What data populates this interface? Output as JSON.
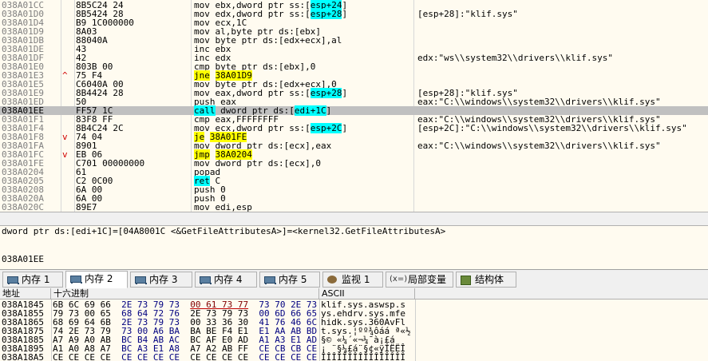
{
  "disasm": {
    "rows": [
      {
        "addr": "038A01CC",
        "jmp": "",
        "hex": "8B5C24 24",
        "ins": [
          {
            "t": "mov ebx,dword ptr ss:["
          },
          {
            "t": "esp+24",
            "hl": "c"
          },
          {
            "t": "]"
          }
        ],
        "cmt": ""
      },
      {
        "addr": "038A01D0",
        "jmp": "",
        "hex": "8B5424 28",
        "ins": [
          {
            "t": "mov edx,dword ptr ss:["
          },
          {
            "t": "esp+28",
            "hl": "c"
          },
          {
            "t": "]"
          }
        ],
        "cmt": "[esp+28]:\"klif.sys\""
      },
      {
        "addr": "038A01D4",
        "jmp": "",
        "hex": "B9 1C000000",
        "ins": [
          {
            "t": "mov ecx,1C"
          }
        ],
        "cmt": ""
      },
      {
        "addr": "038A01D9",
        "jmp": "",
        "hex": "8A03",
        "ins": [
          {
            "t": "mov al,byte ptr ds:[ebx]"
          }
        ],
        "cmt": ""
      },
      {
        "addr": "038A01DB",
        "jmp": "",
        "hex": "88040A",
        "ins": [
          {
            "t": "mov byte ptr ds:[edx+ecx],al"
          }
        ],
        "cmt": ""
      },
      {
        "addr": "038A01DE",
        "jmp": "",
        "hex": "43",
        "ins": [
          {
            "t": "inc ebx"
          }
        ],
        "cmt": ""
      },
      {
        "addr": "038A01DF",
        "jmp": "",
        "hex": "42",
        "ins": [
          {
            "t": "inc edx"
          }
        ],
        "cmt": "edx:\"ws\\\\system32\\\\drivers\\\\klif.sys\""
      },
      {
        "addr": "038A01E0",
        "jmp": "",
        "hex": "803B 00",
        "ins": [
          {
            "t": "cmp byte ptr ds:[ebx],0"
          }
        ],
        "cmt": ""
      },
      {
        "addr": "038A01E3",
        "jmp": "^",
        "hex": "75 F4",
        "ins": [
          {
            "t": "jne",
            "hl": "y"
          },
          {
            "t": " "
          },
          {
            "t": "38A01D9",
            "hl": "y"
          }
        ],
        "cmt": ""
      },
      {
        "addr": "038A01E5",
        "jmp": "",
        "hex": "C6040A 00",
        "ins": [
          {
            "t": "mov byte ptr ds:[edx+ecx],0"
          }
        ],
        "cmt": ""
      },
      {
        "addr": "038A01E9",
        "jmp": "",
        "hex": "8B4424 28",
        "ins": [
          {
            "t": "mov eax,dword ptr ss:["
          },
          {
            "t": "esp+28",
            "hl": "c"
          },
          {
            "t": "]"
          }
        ],
        "cmt": "[esp+28]:\"klif.sys\""
      },
      {
        "addr": "038A01ED",
        "jmp": "",
        "hex": "50",
        "ins": [
          {
            "t": "push eax"
          }
        ],
        "cmt": "eax:\"C:\\\\windows\\\\system32\\\\drivers\\\\klif.sys\""
      },
      {
        "addr": "038A01EE",
        "jmp": "",
        "hex": "FF57 1C",
        "ins": [
          {
            "t": "call",
            "hl": "c"
          },
          {
            "t": " dword ptr ds:["
          },
          {
            "t": "edi+1C",
            "hl": "c"
          },
          {
            "t": "]"
          }
        ],
        "cmt": "",
        "sel": true
      },
      {
        "addr": "038A01F1",
        "jmp": "",
        "hex": "83F8 FF",
        "ins": [
          {
            "t": "cmp eax,FFFFFFFF"
          }
        ],
        "cmt": "eax:\"C:\\\\windows\\\\system32\\\\drivers\\\\klif.sys\""
      },
      {
        "addr": "038A01F4",
        "jmp": "",
        "hex": "8B4C24 2C",
        "ins": [
          {
            "t": "mov ecx,dword ptr ss:["
          },
          {
            "t": "esp+2C",
            "hl": "c"
          },
          {
            "t": "]"
          }
        ],
        "cmt": "[esp+2C]:\"C:\\\\windows\\\\system32\\\\drivers\\\\klif.sys\""
      },
      {
        "addr": "038A01F8",
        "jmp": "v",
        "hex": "74 04",
        "ins": [
          {
            "t": "je",
            "hl": "y"
          },
          {
            "t": " "
          },
          {
            "t": "38A01FE",
            "hl": "y"
          }
        ],
        "cmt": ""
      },
      {
        "addr": "038A01FA",
        "jmp": "",
        "hex": "8901",
        "ins": [
          {
            "t": "mov dword ptr ds:[ecx],eax"
          }
        ],
        "cmt": "eax:\"C:\\\\windows\\\\system32\\\\drivers\\\\klif.sys\""
      },
      {
        "addr": "038A01FC",
        "jmp": "v",
        "hex": "EB 06",
        "ins": [
          {
            "t": "jmp",
            "hl": "y"
          },
          {
            "t": " "
          },
          {
            "t": "38A0204",
            "hl": "y"
          }
        ],
        "cmt": ""
      },
      {
        "addr": "038A01FE",
        "jmp": "",
        "hex": "C701 00000000",
        "ins": [
          {
            "t": "mov dword ptr ds:[ecx],0"
          }
        ],
        "cmt": ""
      },
      {
        "addr": "038A0204",
        "jmp": "",
        "hex": "61",
        "ins": [
          {
            "t": "popad"
          }
        ],
        "cmt": ""
      },
      {
        "addr": "038A0205",
        "jmp": "",
        "hex": "C2 0C00",
        "ins": [
          {
            "t": "ret",
            "hl": "c"
          },
          {
            "t": " C"
          }
        ],
        "cmt": ""
      },
      {
        "addr": "038A0208",
        "jmp": "",
        "hex": "6A 00",
        "ins": [
          {
            "t": "push 0"
          }
        ],
        "cmt": ""
      },
      {
        "addr": "038A020A",
        "jmp": "",
        "hex": "6A 00",
        "ins": [
          {
            "t": "push 0"
          }
        ],
        "cmt": ""
      },
      {
        "addr": "038A020C",
        "jmp": "",
        "hex": "89E7",
        "ins": [
          {
            "t": "mov edi,esp"
          }
        ],
        "cmt": ""
      }
    ]
  },
  "info": {
    "line": "dword ptr ds:[edi+1C]=[04A8001C <&GetFileAttributesA>]=<kernel32.GetFileAttributesA>",
    "address": "038A01EE"
  },
  "tabs": [
    {
      "label": "内存 1",
      "icon": "memory-icon",
      "active": false
    },
    {
      "label": "内存 2",
      "icon": "memory-icon",
      "active": true
    },
    {
      "label": "内存 3",
      "icon": "memory-icon",
      "active": false
    },
    {
      "label": "内存 4",
      "icon": "memory-icon",
      "active": false
    },
    {
      "label": "内存 5",
      "icon": "memory-icon",
      "active": false
    },
    {
      "label": "监视 1",
      "icon": "watch-icon",
      "active": false
    },
    {
      "label": "局部变量",
      "icon": "locals-icon",
      "active": false
    },
    {
      "label": "结构体",
      "icon": "struct-icon",
      "active": false
    }
  ],
  "dump": {
    "headers": {
      "address": "地址",
      "hex": "十六进制",
      "ascii": "ASCII"
    },
    "rows": [
      {
        "addr": "038A1845",
        "g": [
          "6B 6C 69 66",
          "2E 73 79 73",
          "00 61 73 77",
          "73 70 2E 73"
        ],
        "ascii": "klif.sys.aswsp.s"
      },
      {
        "addr": "038A1855",
        "g": [
          "79 73 00 65",
          "68 64 72 76",
          "2E 73 79 73",
          "00 6D 66 65"
        ],
        "ascii": "ys.ehdrv.sys.mfe"
      },
      {
        "addr": "038A1865",
        "g": [
          "68 69 64 6B",
          "2E 73 79 73",
          "00 33 36 30",
          "41 76 46 6C"
        ],
        "ascii": "hidk.sys.360AvFl"
      },
      {
        "addr": "038A1875",
        "g": [
          "74 2E 73 79",
          "73 00 A6 BA",
          "BA BE F4 E1",
          "E1 AA AB BD"
        ],
        "ascii": "t.sys.¦ºº¾ôáá ª«½"
      },
      {
        "addr": "038A1885",
        "g": [
          "A7 A9 A0 AB",
          "BC B4 AB AC",
          "BC AF E0 AD",
          "A1 A3 E1 AD"
        ],
        "ascii": "§© «¼´«¬¼¯à­¡£á­"
      },
      {
        "addr": "038A1895",
        "g": [
          "A1 A0 A8 A7",
          "BC A3 E1 A8",
          "A7 A2 AB FF",
          "CE CB CB CE"
        ],
        "ascii": "¡ ¨§¼£á¨§¢«ÿÎËËÎ"
      },
      {
        "addr": "038A18A5",
        "g": [
          "CE CE CE CE",
          "CE CE CE CE",
          "CE CE CE CE",
          "CE CE CE CE"
        ],
        "ascii": "ÎÎÎÎÎÎÎÎÎÎÎÎÎÎÎÎ"
      }
    ]
  }
}
